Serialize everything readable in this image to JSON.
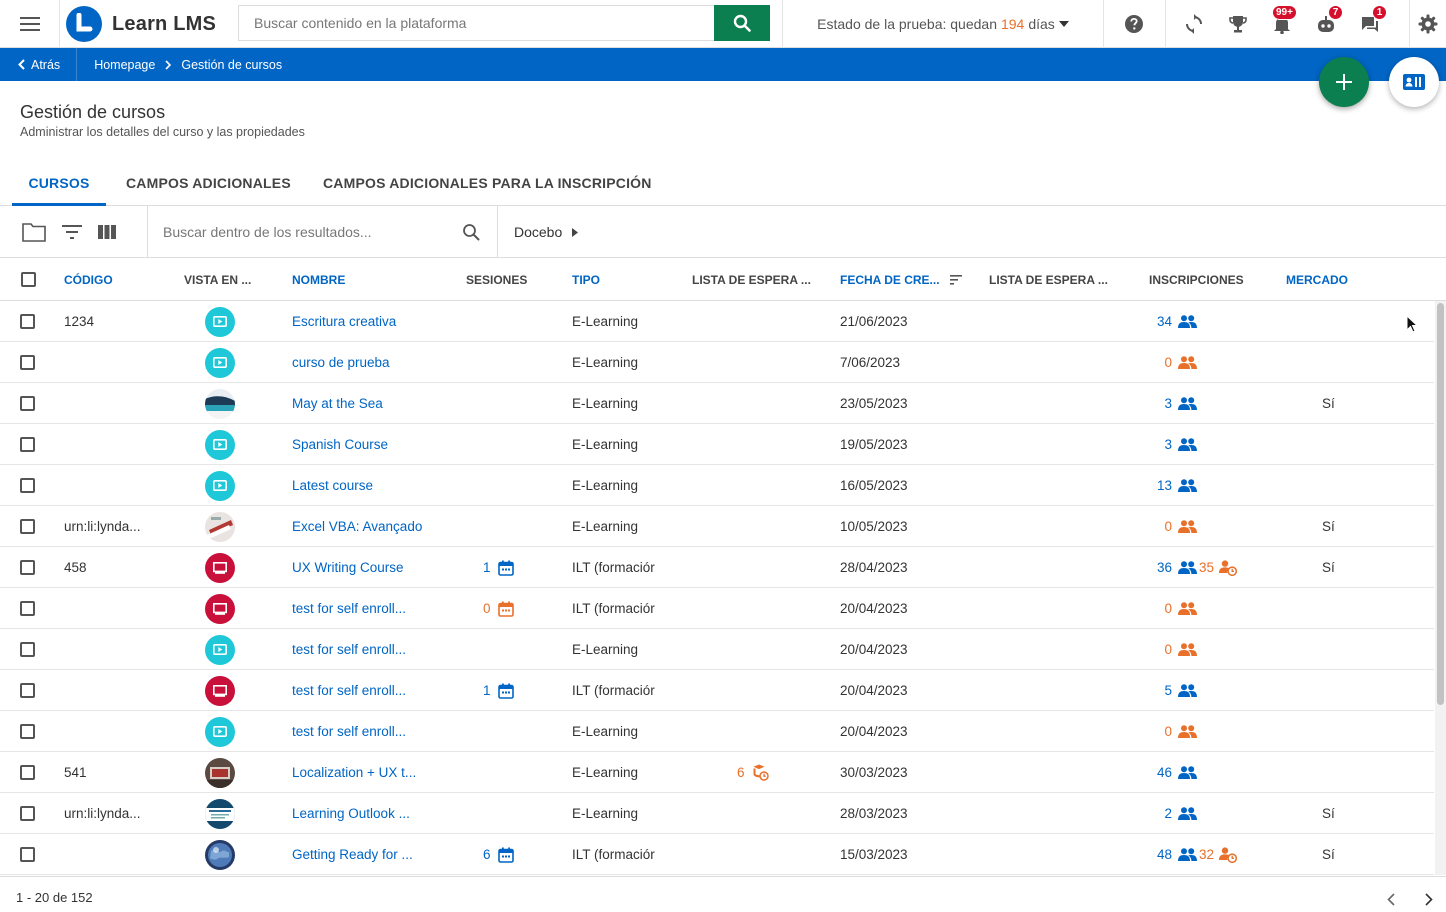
{
  "app": {
    "name": "Learn LMS"
  },
  "header": {
    "search_placeholder": "Buscar contenido en la plataforma",
    "trial_prefix": "Estado de la prueba: quedan",
    "trial_days": "194",
    "trial_suffix": "días",
    "badges": {
      "notifications": "99+",
      "messages": "7",
      "chat": "1"
    }
  },
  "breadcrumb": {
    "back": "Atrás",
    "home": "Homepage",
    "current": "Gestión de cursos"
  },
  "page": {
    "title": "Gestión de cursos",
    "subtitle": "Administrar los detalles del curso y las propiedades"
  },
  "tabs": [
    "CURSOS",
    "CAMPOS ADICIONALES",
    "CAMPOS ADICIONALES PARA LA INSCRIPCIÓN"
  ],
  "toolbar": {
    "search_placeholder": "Buscar dentro de los resultados...",
    "catalog": "Docebo"
  },
  "columns": [
    "CÓDIGO",
    "VISTA EN ...",
    "NOMBRE",
    "SESIONES",
    "TIPO",
    "LISTA DE ESPERA ...",
    "FECHA DE CRE...",
    "LISTA DE ESPERA ...",
    "INSCRIPCIONES",
    "MERCADO"
  ],
  "rows": [
    {
      "code": "1234",
      "thumb": "elearning",
      "name": "Escritura creativa",
      "sessions": "",
      "type": "E-Learning",
      "waitlist": "",
      "date": "21/06/2023",
      "enrollments": "34",
      "pending": "",
      "market": ""
    },
    {
      "code": "",
      "thumb": "elearning",
      "name": "curso de prueba",
      "sessions": "",
      "type": "E-Learning",
      "waitlist": "",
      "date": "7/06/2023",
      "enrollments": "0",
      "pending": "",
      "market": ""
    },
    {
      "code": "",
      "thumb": "sea",
      "name": "May at the Sea",
      "sessions": "",
      "type": "E-Learning",
      "waitlist": "",
      "date": "23/05/2023",
      "enrollments": "3",
      "pending": "",
      "market": "Sí"
    },
    {
      "code": "",
      "thumb": "elearning",
      "name": "Spanish Course",
      "sessions": "",
      "type": "E-Learning",
      "waitlist": "",
      "date": "19/05/2023",
      "enrollments": "3",
      "pending": "",
      "market": ""
    },
    {
      "code": "",
      "thumb": "elearning",
      "name": "Latest course",
      "sessions": "",
      "type": "E-Learning",
      "waitlist": "",
      "date": "16/05/2023",
      "enrollments": "13",
      "pending": "",
      "market": ""
    },
    {
      "code": "urn:li:lynda...",
      "thumb": "excel",
      "name": "Excel VBA: Avançado",
      "sessions": "",
      "type": "E-Learning",
      "waitlist": "",
      "date": "10/05/2023",
      "enrollments": "0",
      "pending": "",
      "market": "Sí"
    },
    {
      "code": "458",
      "thumb": "ilt",
      "name": "UX Writing Course",
      "sessions": "1",
      "type": "ILT (formaciór",
      "waitlist": "",
      "date": "28/04/2023",
      "enrollments": "36",
      "pending": "35",
      "market": "Sí"
    },
    {
      "code": "",
      "thumb": "ilt",
      "name": "test for self enroll...",
      "sessions": "0",
      "type": "ILT (formaciór",
      "waitlist": "",
      "date": "20/04/2023",
      "enrollments": "0",
      "pending": "",
      "market": ""
    },
    {
      "code": "",
      "thumb": "elearning",
      "name": "test for self enroll...",
      "sessions": "",
      "type": "E-Learning",
      "waitlist": "",
      "date": "20/04/2023",
      "enrollments": "0",
      "pending": "",
      "market": ""
    },
    {
      "code": "",
      "thumb": "ilt",
      "name": "test for self enroll...",
      "sessions": "1",
      "type": "ILT (formaciór",
      "waitlist": "",
      "date": "20/04/2023",
      "enrollments": "5",
      "pending": "",
      "market": ""
    },
    {
      "code": "",
      "thumb": "elearning",
      "name": "test for self enroll...",
      "sessions": "",
      "type": "E-Learning",
      "waitlist": "",
      "date": "20/04/2023",
      "enrollments": "0",
      "pending": "",
      "market": ""
    },
    {
      "code": "541",
      "thumb": "localization",
      "name": "Localization + UX t...",
      "sessions": "",
      "type": "E-Learning",
      "waitlist": "6",
      "date": "30/03/2023",
      "enrollments": "46",
      "pending": "",
      "market": ""
    },
    {
      "code": "urn:li:lynda...",
      "thumb": "outlook",
      "name": "Learning Outlook ...",
      "sessions": "",
      "type": "E-Learning",
      "waitlist": "",
      "date": "28/03/2023",
      "enrollments": "2",
      "pending": "",
      "market": "Sí"
    },
    {
      "code": "",
      "thumb": "globe",
      "name": "Getting Ready for ...",
      "sessions": "6",
      "type": "ILT (formaciór",
      "waitlist": "",
      "date": "15/03/2023",
      "enrollments": "48",
      "pending": "32",
      "market": "Sí"
    }
  ],
  "pagination": {
    "label": "1 - 20 de 152"
  },
  "colors": {
    "brand_blue": "#0065c4",
    "accent_green": "#0b7f4f",
    "orange": "#e8702a",
    "elearning_teal": "#1ec8d8",
    "ilt_red": "#c8103a"
  }
}
